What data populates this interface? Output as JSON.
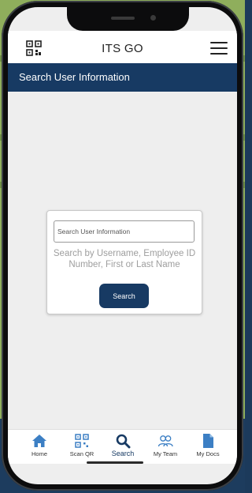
{
  "app": {
    "title": "ITS GO"
  },
  "subheader": {
    "title": "Search User Information"
  },
  "search": {
    "placeholder": "Search User Information",
    "help_text": "Search by Username, Employee ID Number, First or Last Name",
    "button_label": "Search"
  },
  "nav": {
    "items": [
      {
        "label": "Home",
        "icon": "home-icon"
      },
      {
        "label": "Scan QR",
        "icon": "qr-code-icon"
      },
      {
        "label": "Search",
        "icon": "search-icon",
        "active": true
      },
      {
        "label": "My Team",
        "icon": "team-icon"
      },
      {
        "label": "My Docs",
        "icon": "document-icon"
      }
    ]
  },
  "colors": {
    "primary": "#173a63",
    "nav_icon": "#3c7fc4",
    "background": "#eeeeee"
  }
}
